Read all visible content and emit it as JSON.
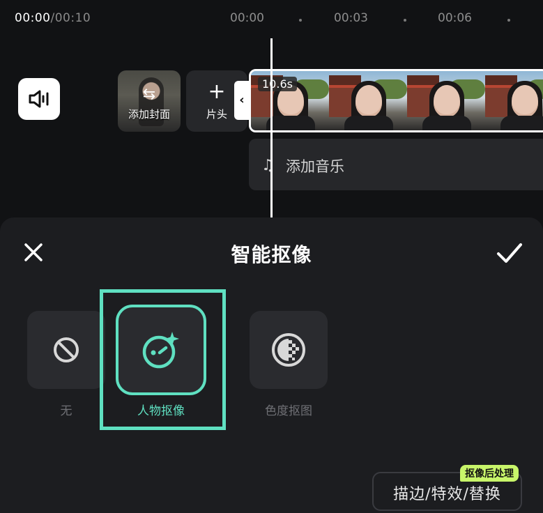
{
  "timeline": {
    "current_time": "00:00",
    "total_time": "/00:10",
    "ruler_labels": [
      "00:00",
      "00:03",
      "00:06"
    ],
    "cover_label": "添加封面",
    "intro_label": "片头",
    "clip_duration": "10.6s",
    "music_label": "添加音乐"
  },
  "panel": {
    "title": "智能抠像",
    "options": [
      {
        "label": "无",
        "icon": "ban-icon",
        "selected": false
      },
      {
        "label": "人物抠像",
        "icon": "portrait-cutout-icon",
        "selected": true
      },
      {
        "label": "色度抠图",
        "icon": "chroma-key-icon",
        "selected": false
      }
    ],
    "post_badge": "抠像后处理",
    "post_button": "描边/特效/替换"
  },
  "colors": {
    "accent": "#5fe0c1",
    "badge": "#c8f56a",
    "panel_bg": "#1c1d20",
    "tile_bg": "#2a2b2f"
  }
}
